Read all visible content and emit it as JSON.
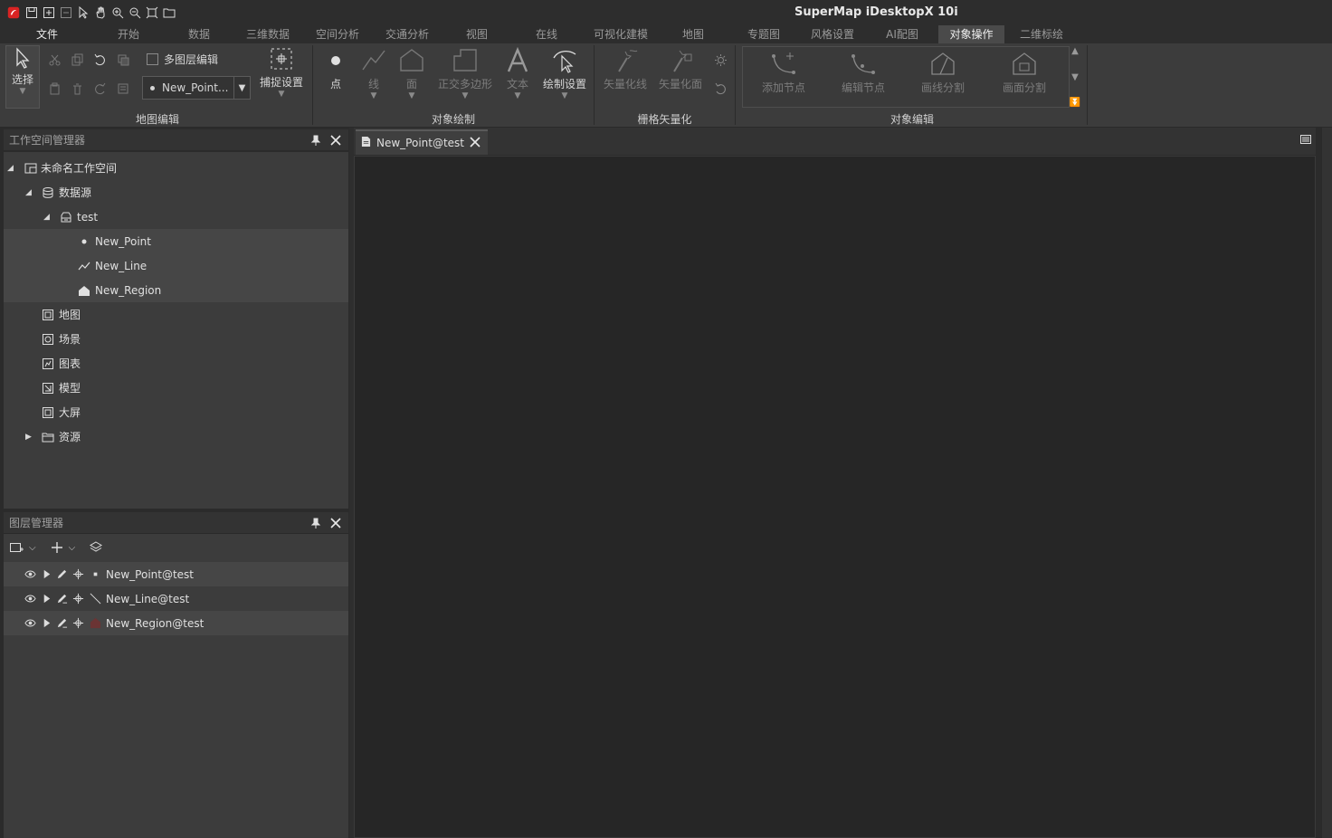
{
  "app": {
    "title": "SuperMap iDesktopX 10i"
  },
  "menu_tabs": [
    {
      "label": "文件"
    },
    {
      "label": "开始"
    },
    {
      "label": "数据"
    },
    {
      "label": "三维数据"
    },
    {
      "label": "空间分析"
    },
    {
      "label": "交通分析"
    },
    {
      "label": "视图"
    },
    {
      "label": "在线"
    },
    {
      "label": "可视化建模"
    },
    {
      "label": "地图"
    },
    {
      "label": "专题图"
    },
    {
      "label": "风格设置"
    },
    {
      "label": "AI配图"
    },
    {
      "label": "对象操作"
    },
    {
      "label": "二维标绘"
    }
  ],
  "active_tab": "对象操作",
  "ribbon": {
    "map_edit": {
      "group_label": "地图编辑",
      "select_label": "选择",
      "multi_layer_label": "多图层编辑",
      "layer_combo_value": "New_Point...",
      "snap_label": "捕捉设置"
    },
    "object_draw": {
      "group_label": "对象绘制",
      "point_label": "点",
      "line_label": "线",
      "region_label": "面",
      "ortho_label": "正交多边形",
      "text_label": "文本",
      "draw_settings_label": "绘制设置"
    },
    "raster_vec": {
      "group_label": "栅格矢量化",
      "vec_line_label": "矢量化线",
      "vec_region_label": "矢量化面"
    },
    "object_edit": {
      "group_label": "对象编辑",
      "add_node_label": "添加节点",
      "edit_node_label": "编辑节点",
      "line_split_label": "画线分割",
      "region_split_label": "画面分割"
    }
  },
  "workspace_panel": {
    "title": "工作空间管理器",
    "tree": {
      "workspace": "未命名工作空间",
      "datasources": "数据源",
      "datasource": "test",
      "datasets": [
        "New_Point",
        "New_Line",
        "New_Region"
      ],
      "maps": "地图",
      "scenes": "场景",
      "charts": "图表",
      "models": "模型",
      "screens": "大屏",
      "resources": "资源"
    }
  },
  "layer_panel": {
    "title": "图层管理器",
    "layers": [
      "New_Point@test",
      "New_Line@test",
      "New_Region@test"
    ]
  },
  "document": {
    "tab_title": "New_Point@test"
  },
  "colors": {
    "region_swatch": "#6b3434",
    "accent_tab": "#4a4a4a"
  }
}
